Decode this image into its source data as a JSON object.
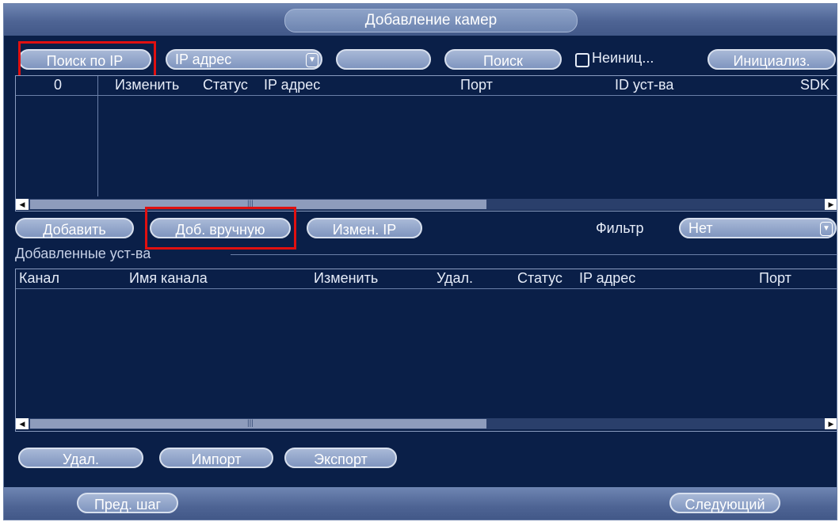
{
  "title": "Добавление камер",
  "search_bar": {
    "search_ip_label": "Поиск по IP",
    "search_type_value": "IP адрес",
    "search_field_value": "",
    "search_label": "Поиск",
    "uninit_label": "Неиниц...",
    "initialize_label": "Инициализ."
  },
  "found_table": {
    "count": "0",
    "columns": [
      "Изменить",
      "Статус",
      "IP адрес",
      "Порт",
      "ID уст-ва",
      "SDK"
    ],
    "rows": []
  },
  "actions": {
    "add_label": "Добавить",
    "manual_add_label": "Доб. вручную",
    "change_ip_label": "Измен. IP",
    "filter_label": "Фильтр",
    "filter_value": "Нет"
  },
  "added_section": {
    "title": "Добавленные уст-ва",
    "columns": [
      "Канал",
      "Имя канала",
      "Изменить",
      "Удал.",
      "Статус",
      "IP адрес",
      "Порт"
    ],
    "rows": []
  },
  "bottom_actions": {
    "delete_label": "Удал.",
    "import_label": "Импорт",
    "export_label": "Экспорт"
  },
  "footer": {
    "prev_label": "Пред. шаг",
    "next_label": "Следующий"
  },
  "colors": {
    "background": "#0a1f48",
    "highlight": "#e01010"
  }
}
